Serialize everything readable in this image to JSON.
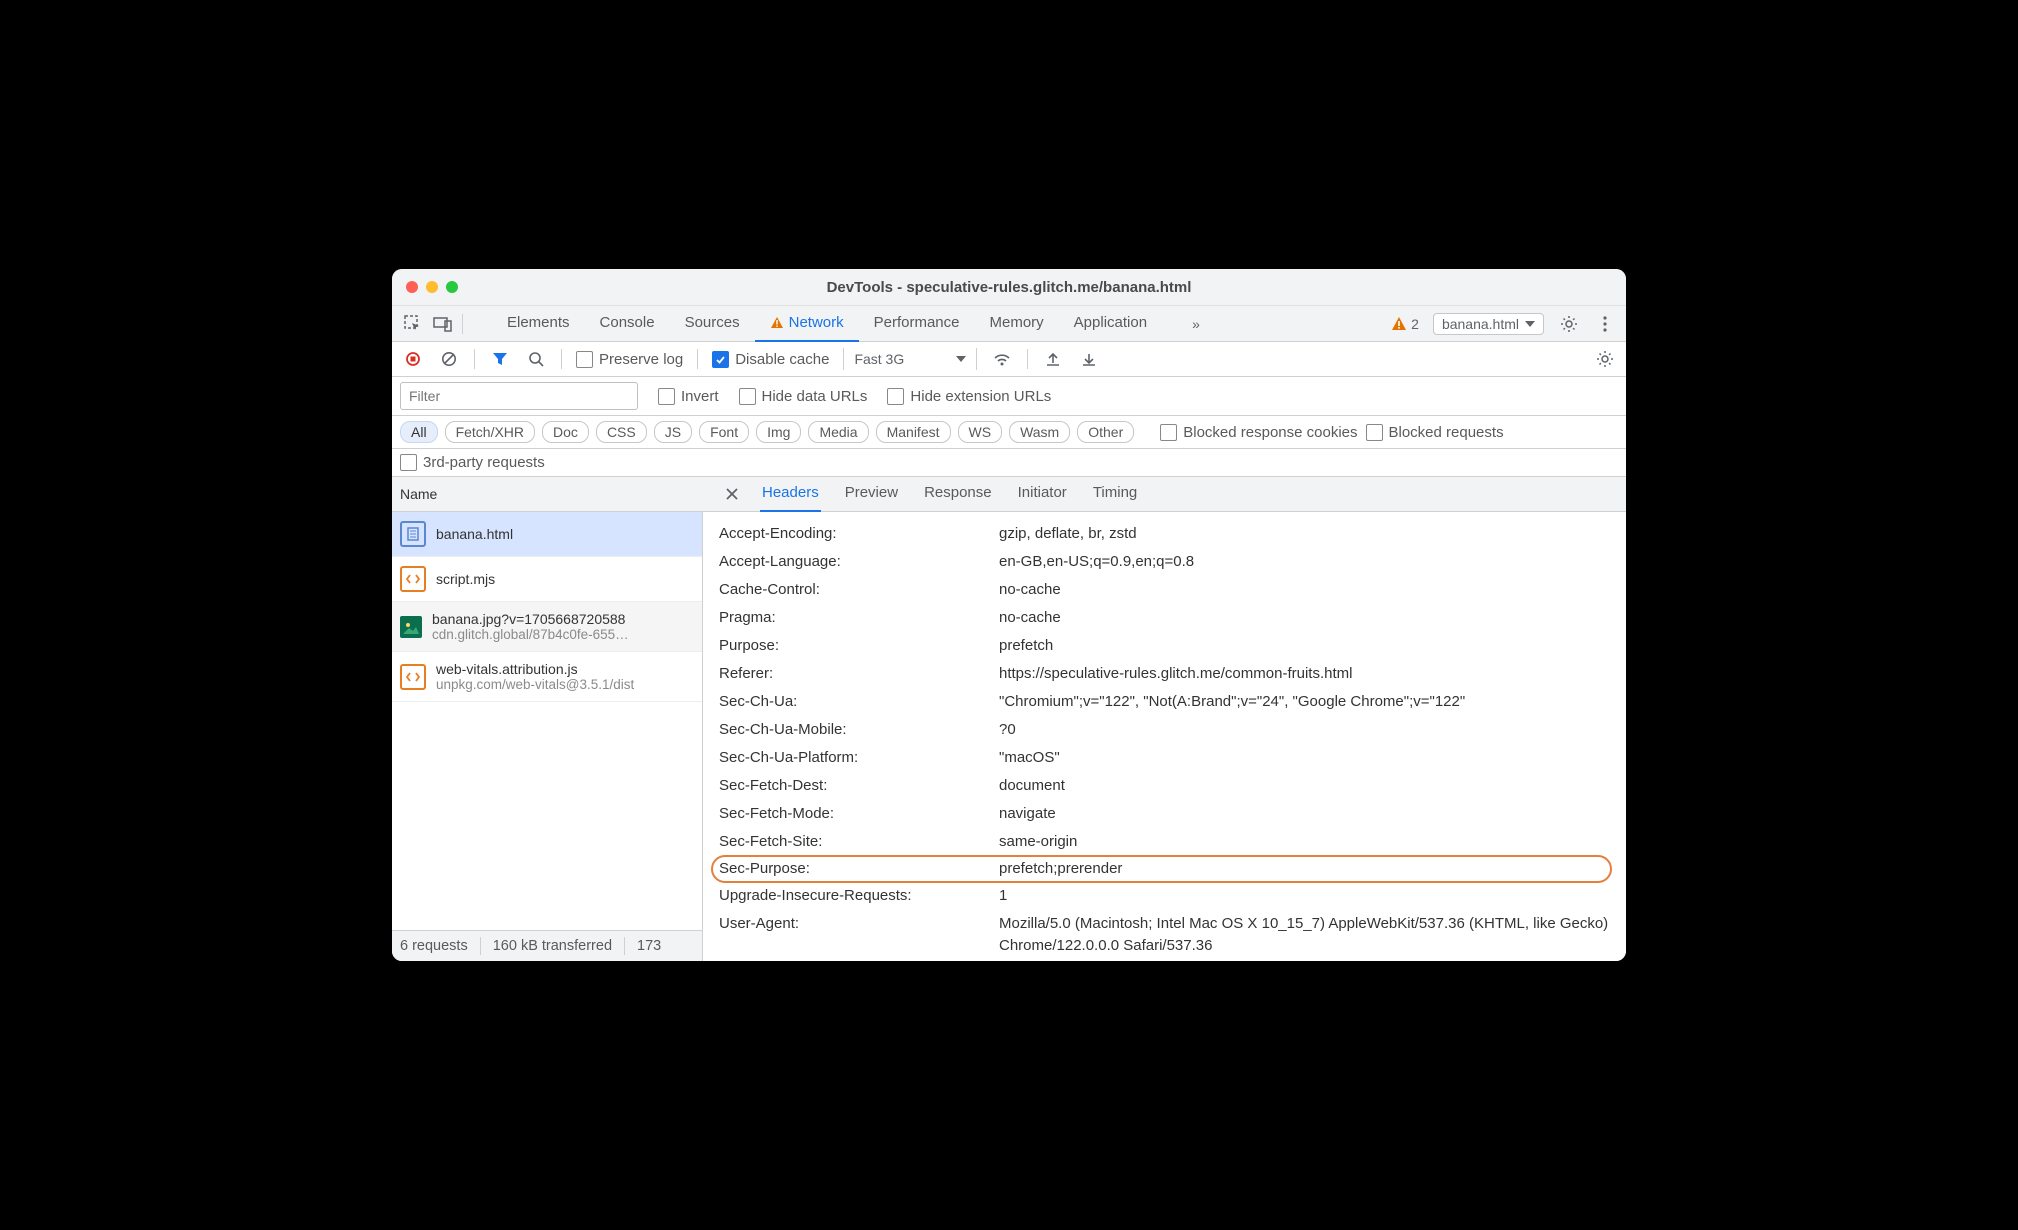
{
  "window": {
    "title": "DevTools - speculative-rules.glitch.me/banana.html"
  },
  "tabs": {
    "items": [
      "Elements",
      "Console",
      "Sources",
      "Network",
      "Performance",
      "Memory",
      "Application"
    ],
    "active": "Network",
    "more": "»",
    "issues_count": "2",
    "context_label": "banana.html"
  },
  "toolbar": {
    "preserve_log": "Preserve log",
    "disable_cache": "Disable cache",
    "throttling": "Fast 3G"
  },
  "filters": {
    "placeholder": "Filter",
    "invert": "Invert",
    "hide_data": "Hide data URLs",
    "hide_ext": "Hide extension URLs"
  },
  "chips": [
    "All",
    "Fetch/XHR",
    "Doc",
    "CSS",
    "JS",
    "Font",
    "Img",
    "Media",
    "Manifest",
    "WS",
    "Wasm",
    "Other"
  ],
  "extra_filters": {
    "blocked_cookies": "Blocked response cookies",
    "blocked_requests": "Blocked requests",
    "third_party": "3rd-party requests"
  },
  "request_list": {
    "header": "Name",
    "items": [
      {
        "name": "banana.html",
        "domain": "",
        "icon": "doc",
        "selected": true
      },
      {
        "name": "script.mjs",
        "domain": "",
        "icon": "js"
      },
      {
        "name": "banana.jpg?v=1705668720588",
        "domain": "cdn.glitch.global/87b4c0fe-655…",
        "icon": "img",
        "stripe": true
      },
      {
        "name": "web-vitals.attribution.js",
        "domain": "unpkg.com/web-vitals@3.5.1/dist",
        "icon": "js"
      }
    ]
  },
  "subtabs": {
    "items": [
      "Headers",
      "Preview",
      "Response",
      "Initiator",
      "Timing"
    ],
    "active": "Headers"
  },
  "headers_pane": {
    "rows": [
      {
        "name": "Accept-Encoding:",
        "value": "gzip, deflate, br, zstd"
      },
      {
        "name": "Accept-Language:",
        "value": "en-GB,en-US;q=0.9,en;q=0.8"
      },
      {
        "name": "Cache-Control:",
        "value": "no-cache"
      },
      {
        "name": "Pragma:",
        "value": "no-cache"
      },
      {
        "name": "Purpose:",
        "value": "prefetch"
      },
      {
        "name": "Referer:",
        "value": "https://speculative-rules.glitch.me/common-fruits.html"
      },
      {
        "name": "Sec-Ch-Ua:",
        "value": "\"Chromium\";v=\"122\", \"Not(A:Brand\";v=\"24\", \"Google Chrome\";v=\"122\""
      },
      {
        "name": "Sec-Ch-Ua-Mobile:",
        "value": "?0"
      },
      {
        "name": "Sec-Ch-Ua-Platform:",
        "value": "\"macOS\""
      },
      {
        "name": "Sec-Fetch-Dest:",
        "value": "document"
      },
      {
        "name": "Sec-Fetch-Mode:",
        "value": "navigate"
      },
      {
        "name": "Sec-Fetch-Site:",
        "value": "same-origin"
      },
      {
        "name": "Sec-Purpose:",
        "value": "prefetch;prerender",
        "highlight": true
      },
      {
        "name": "Upgrade-Insecure-Requests:",
        "value": "1"
      },
      {
        "name": "User-Agent:",
        "value": "Mozilla/5.0 (Macintosh; Intel Mac OS X 10_15_7) AppleWebKit/537.36 (KHTML, like Gecko) Chrome/122.0.0.0 Safari/537.36"
      }
    ]
  },
  "status": {
    "requests": "6 requests",
    "transferred": "160 kB transferred",
    "resources": "173"
  }
}
